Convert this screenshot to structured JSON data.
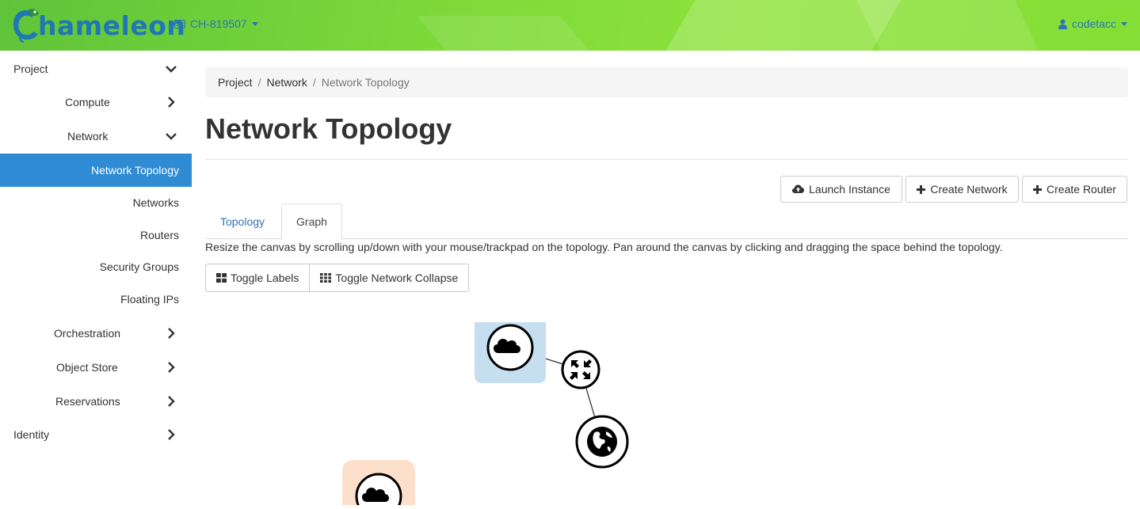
{
  "header": {
    "logo_text": "hameleon",
    "project": "CH-819507",
    "user": "codetacc"
  },
  "sidebar": {
    "items": [
      {
        "label": "Project",
        "level": 0,
        "chevron": "down"
      },
      {
        "label": "Compute",
        "level": 1,
        "chevron": "right"
      },
      {
        "label": "Network",
        "level": 1,
        "chevron": "down"
      },
      {
        "label": "Network Topology",
        "level": 2,
        "active": true
      },
      {
        "label": "Networks",
        "level": 2
      },
      {
        "label": "Routers",
        "level": 2
      },
      {
        "label": "Security Groups",
        "level": 2
      },
      {
        "label": "Floating IPs",
        "level": 2
      },
      {
        "label": "Orchestration",
        "level": 1,
        "chevron": "right"
      },
      {
        "label": "Object Store",
        "level": 1,
        "chevron": "right"
      },
      {
        "label": "Reservations",
        "level": 1,
        "chevron": "right"
      },
      {
        "label": "Identity",
        "level": 0,
        "chevron": "right"
      }
    ]
  },
  "breadcrumb": [
    "Project",
    "Network",
    "Network Topology"
  ],
  "page": {
    "title": "Network Topology",
    "actions": {
      "launch_instance": "Launch Instance",
      "create_network": "Create Network",
      "create_router": "Create Router"
    },
    "tabs": [
      "Topology",
      "Graph"
    ],
    "active_tab": "Graph",
    "help_text": "Resize the canvas by scrolling up/down with your mouse/trackpad on the topology. Pan around the canvas by clicking and dragging the space behind the topology.",
    "graph_buttons": {
      "toggle_labels": "Toggle Labels",
      "toggle_collapse": "Toggle Network Collapse"
    }
  },
  "topology": {
    "nodes": [
      {
        "kind": "network",
        "icon": "cloud-icon",
        "tint": "#c6dff0"
      },
      {
        "kind": "network",
        "icon": "cloud-icon",
        "tint": "#fde0cc"
      },
      {
        "kind": "router",
        "icon": "router-arrows-icon"
      },
      {
        "kind": "external-network",
        "icon": "globe-icon"
      }
    ]
  },
  "colors": {
    "brand_green": "#7bd73a",
    "link_blue": "#2e73b8",
    "active_nav": "#2e8bd4",
    "network_blue_tint": "#c6dff0",
    "network_orange_tint": "#fde0cc"
  }
}
